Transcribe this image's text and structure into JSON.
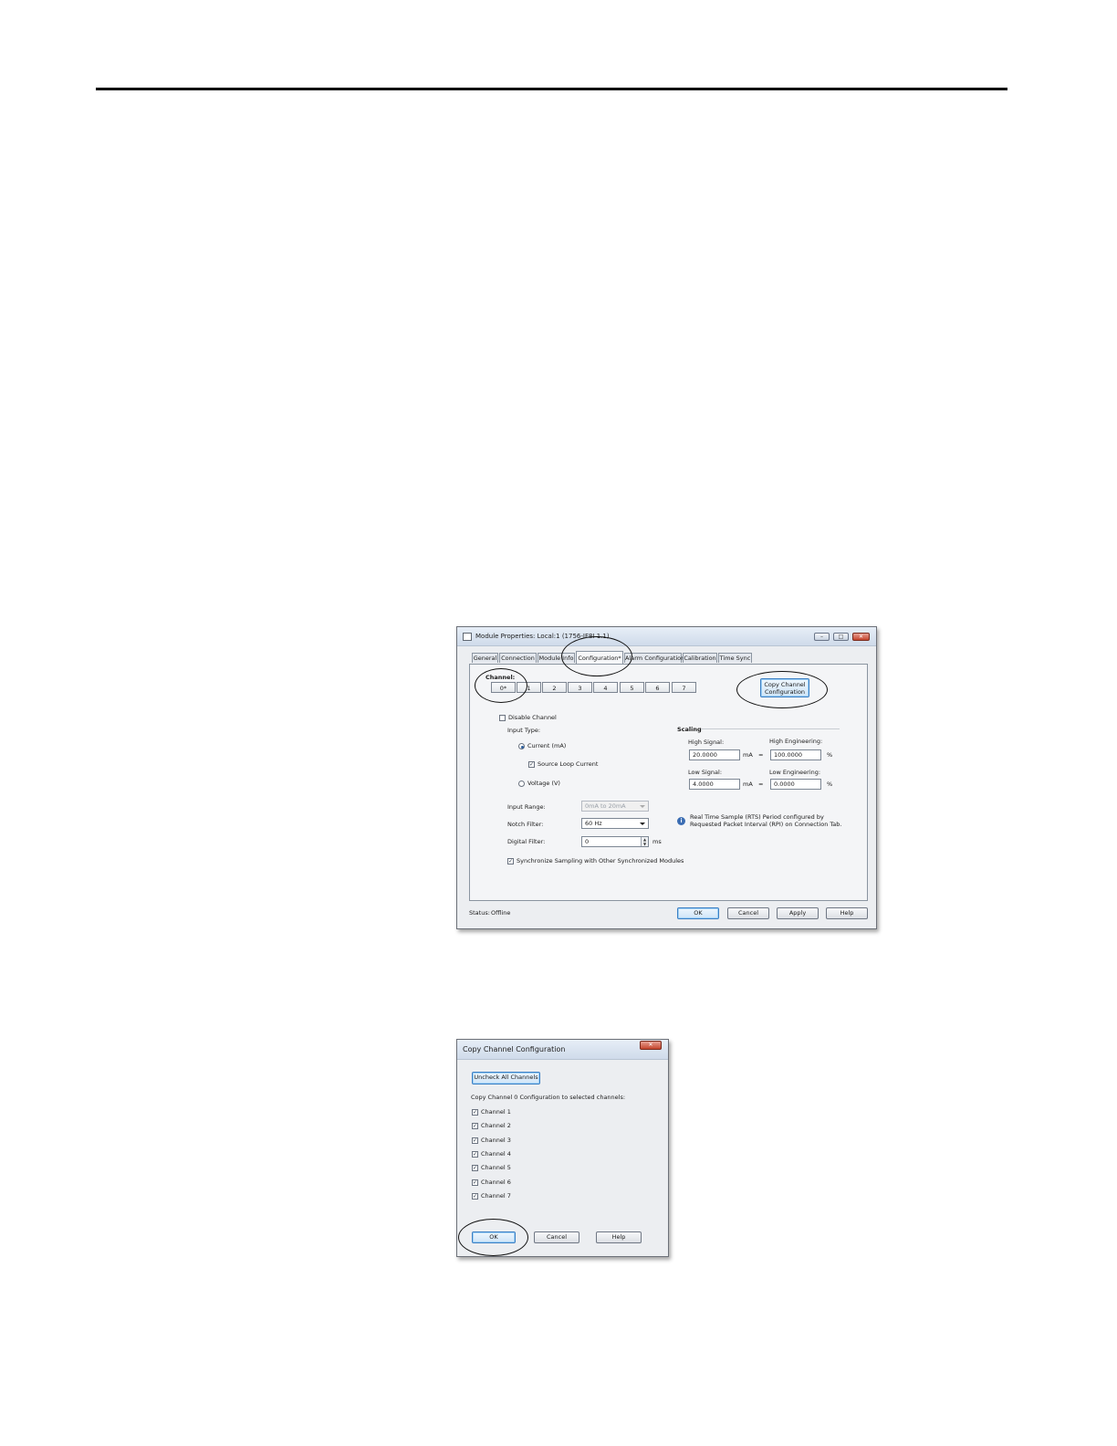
{
  "module_window": {
    "title": "Module Properties: Local:1 (1756-IF8I 1.1)",
    "tabs": [
      {
        "label": "General"
      },
      {
        "label": "Connection"
      },
      {
        "label": "Module Info"
      },
      {
        "label": "Configuration*"
      },
      {
        "label": "Alarm Configuration"
      },
      {
        "label": "Calibration"
      },
      {
        "label": "Time Sync"
      }
    ],
    "channel_label": "Channel:",
    "channels": [
      "0*",
      "1",
      "2",
      "3",
      "4",
      "5",
      "6",
      "7"
    ],
    "copy_button": "Copy Channel Configuration",
    "disable_channel": "Disable Channel",
    "input_type_label": "Input Type:",
    "current_option": "Current (mA)",
    "source_loop_current": "Source Loop Current",
    "voltage_option": "Voltage (V)",
    "input_range_label": "Input Range:",
    "input_range_value": "0mA to 20mA",
    "notch_filter_label": "Notch Filter:",
    "notch_filter_value": "60 Hz",
    "digital_filter_label": "Digital Filter:",
    "digital_filter_value": "0",
    "digital_filter_unit": "ms",
    "sync_sampling": "Synchronize Sampling with Other Synchronized Modules",
    "scaling": {
      "title": "Scaling",
      "high_signal_label": "High Signal:",
      "high_signal_value": "20.0000",
      "high_eng_label": "High Engineering:",
      "high_eng_value": "100.0000",
      "low_signal_label": "Low Signal:",
      "low_signal_value": "4.0000",
      "low_eng_label": "Low Engineering:",
      "low_eng_value": "0.0000",
      "signal_unit": "mA",
      "eng_unit": "%",
      "equals": "="
    },
    "rts_note_line1": "Real Time Sample (RTS) Period configured by",
    "rts_note_line2": "Requested Packet Interval (RPI) on Connection Tab.",
    "status_label": "Status:",
    "status_value": "Offline",
    "buttons": {
      "ok": "OK",
      "cancel": "Cancel",
      "apply": "Apply",
      "help": "Help"
    }
  },
  "copy_dialog": {
    "title": "Copy Channel Configuration",
    "uncheck_button": "Uncheck All Channels",
    "instruction": "Copy Channel 0 Configuration to selected channels:",
    "channels": [
      "Channel 1",
      "Channel 2",
      "Channel 3",
      "Channel 4",
      "Channel 5",
      "Channel 6",
      "Channel 7"
    ],
    "buttons": {
      "ok": "OK",
      "cancel": "Cancel",
      "help": "Help"
    }
  }
}
